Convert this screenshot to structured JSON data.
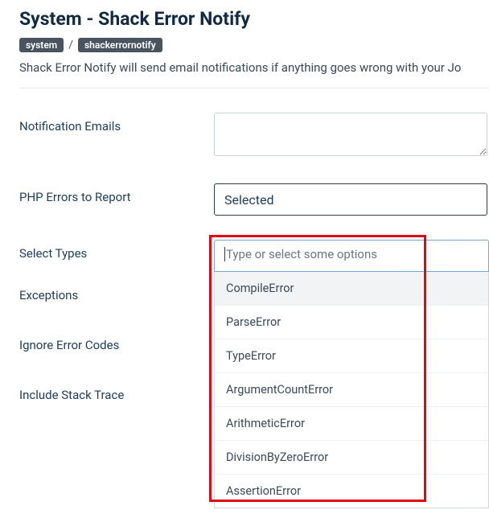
{
  "page": {
    "title": "System - Shack Error Notify",
    "description": "Shack Error Notify will send email notifications if anything goes wrong with your Jo"
  },
  "breadcrumb": {
    "segments": [
      "system",
      "shackerrornotify"
    ],
    "separator": "/"
  },
  "form": {
    "notification_emails": {
      "label": "Notification Emails",
      "value": ""
    },
    "php_errors": {
      "label": "PHP Errors to Report",
      "value": "Selected"
    },
    "select_types": {
      "label": "Select Types",
      "placeholder": "Type or select some options",
      "options": [
        {
          "label": "CompileError",
          "hover": true
        },
        {
          "label": "ParseError",
          "hover": false
        },
        {
          "label": "TypeError",
          "hover": false
        },
        {
          "label": "ArgumentCountError",
          "hover": false
        },
        {
          "label": "ArithmeticError",
          "hover": false
        },
        {
          "label": "DivisionByZeroError",
          "hover": false
        },
        {
          "label": "AssertionError",
          "hover": false
        }
      ]
    },
    "exceptions": {
      "label": "Exceptions"
    },
    "ignore_codes": {
      "label": "Ignore Error Codes"
    },
    "stack_trace": {
      "label": "Include Stack Trace"
    }
  }
}
